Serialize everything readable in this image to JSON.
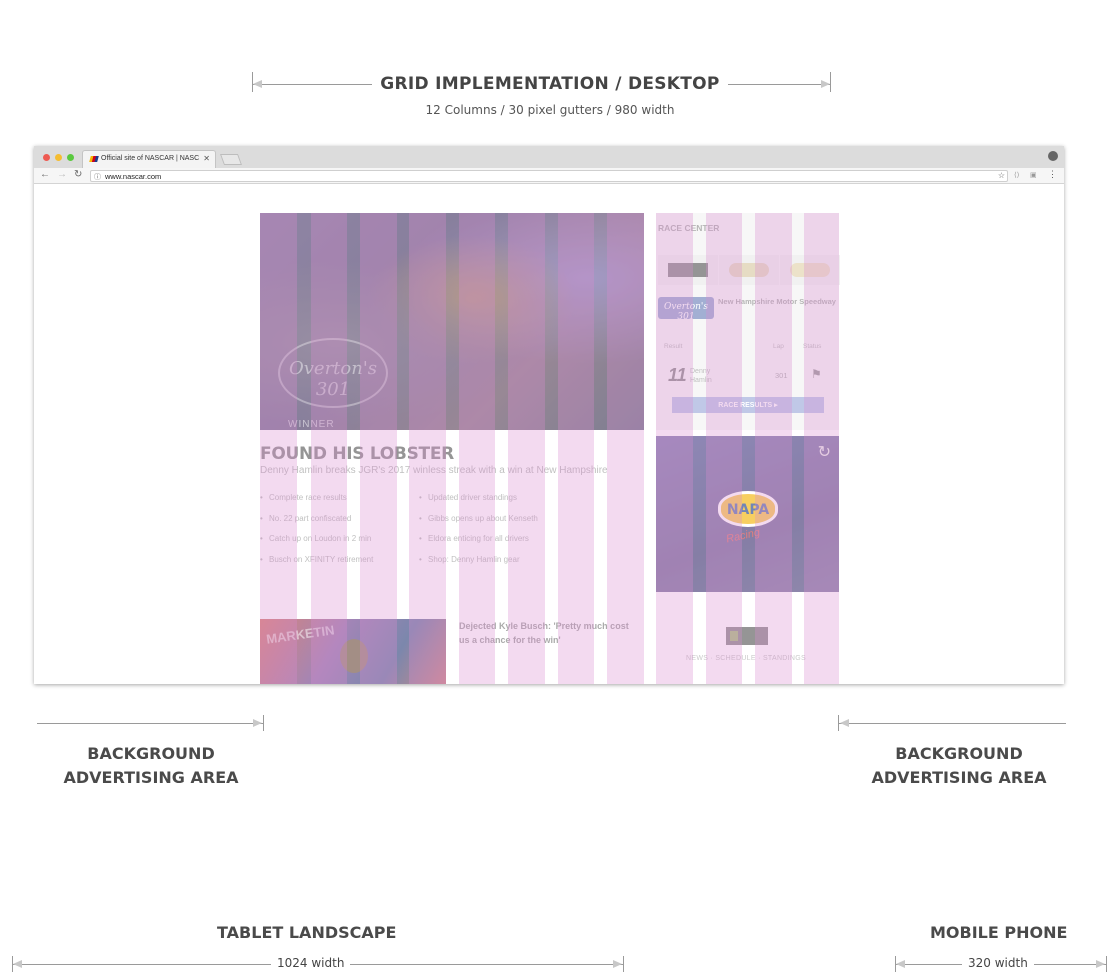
{
  "header": {
    "title": "GRID IMPLEMENTATION  /  DESKTOP",
    "subtitle": "12 Columns / 30 pixel gutters / 980 width"
  },
  "browser": {
    "tab_title": "Official site of NASCAR | NASC",
    "url": "www.nascar.com"
  },
  "site": {
    "hero_badge": "Overton's 301",
    "hero_winner": "WINNER",
    "headline": "FOUND HIS LOBSTER",
    "subheadline": "Denny Hamlin breaks JGR's 2017 winless streak with a win at New Hampshire",
    "bullets_left": [
      "Complete race results",
      "No. 22 part confiscated",
      "Catch up on Loudon in 2 min",
      "Busch on XFINITY retirement"
    ],
    "bullets_right": [
      "Updated driver standings",
      "Gibbs opens up about Kenseth",
      "Eldora enticing for all drivers",
      "Shop: Denny Hamlin gear"
    ],
    "story_title": "Dejected Kyle Busch: 'Pretty much cost us a chance for the win'",
    "story_thumb_text": "MARKETIN",
    "race_center": {
      "title": "RACE CENTER",
      "event_logo": "Overton's 301",
      "track": "New Hampshire Motor Speedway",
      "col_result": "Result",
      "col_lap": "Lap",
      "col_status": "Status",
      "car_number": "11",
      "driver": "Denny Hamlin",
      "lap": "301",
      "results_button": "RACE RESULTS ▸"
    },
    "ad": {
      "brand": "NAPA",
      "tagline": "Racing"
    },
    "footer_links": "NEWS  ·  SCHEDULE  ·  STANDINGS"
  },
  "annotations": {
    "bg_left": [
      "BACKGROUND",
      "ADVERTISING AREA"
    ],
    "bg_right": [
      "BACKGROUND",
      "ADVERTISING AREA"
    ],
    "tablet_label": "TABLET LANDSCAPE",
    "tablet_width": "1024 width",
    "mobile_label": "MOBILE PHONE",
    "mobile_width": "320 width"
  },
  "colors": {
    "grid_column": "#da8cd0",
    "heading": "#4a4a4a",
    "hero_purple": "#4b3a6e"
  }
}
